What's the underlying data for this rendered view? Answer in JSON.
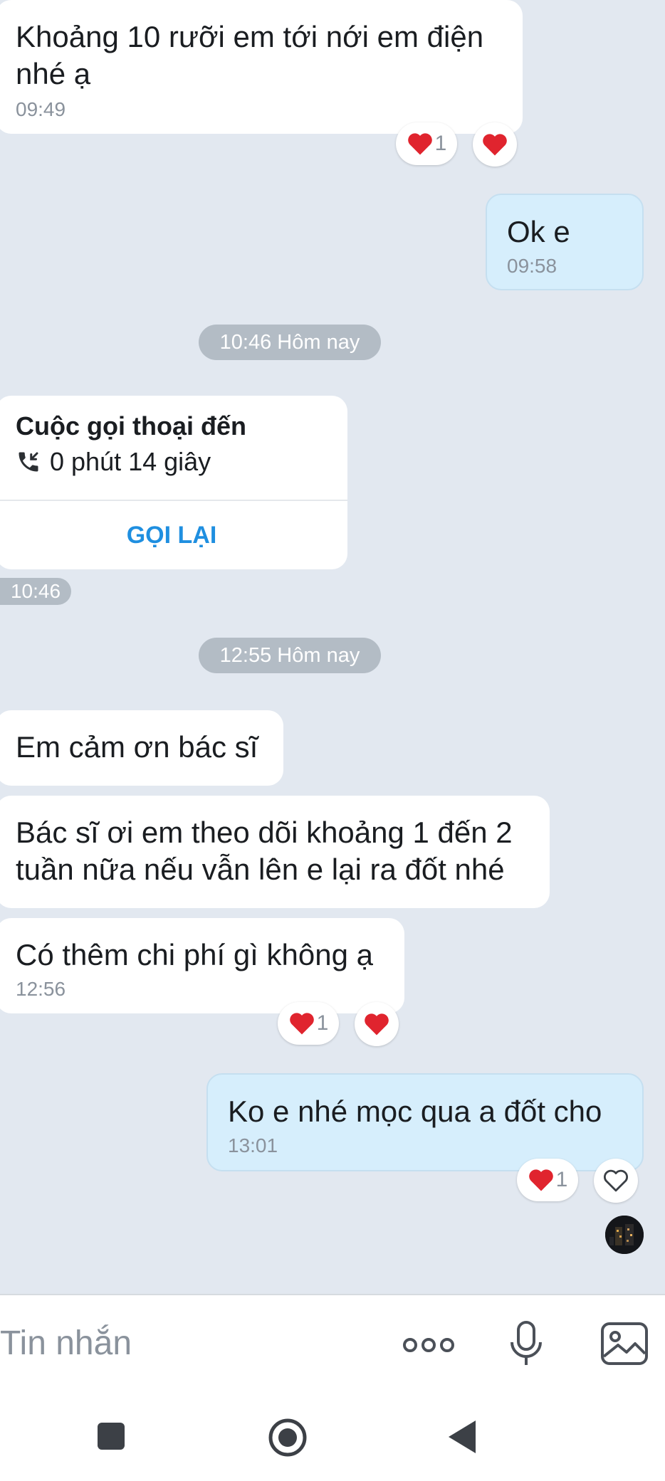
{
  "messages": {
    "m1": {
      "text": "Khoảng 10 rưỡi em tới nới em điện nhé ạ",
      "time": "09:49",
      "reaction_count": "1"
    },
    "m2": {
      "text": "Ok e",
      "time": "09:58"
    },
    "m3": {
      "text": "Em cảm ơn bác sĩ"
    },
    "m4": {
      "text": "Bác sĩ ơi em theo dõi khoảng 1 đến 2 tuần nữa nếu vẫn lên e lại ra đốt nhé"
    },
    "m5": {
      "text": "Có thêm chi phí gì không ạ",
      "time": "12:56",
      "reaction_count": "1"
    },
    "m6": {
      "text": "Ko e nhé mọc qua a đốt cho",
      "time": "13:01",
      "reaction_count": "1"
    }
  },
  "separators": {
    "s1": "10:46 Hôm nay",
    "s2": "12:55 Hôm nay"
  },
  "call_card": {
    "title": "Cuộc gọi thoại đến",
    "duration": "0 phút 14 giây",
    "action": "GỌI LẠI",
    "time": "10:46"
  },
  "composer": {
    "placeholder": "Tin nhắn"
  },
  "icons": {
    "heart": "heart-icon",
    "heart_outline": "heart-outline-icon",
    "phone_incoming": "phone-incoming-icon",
    "more": "more-icon",
    "mic": "microphone-icon",
    "image": "image-icon"
  },
  "colors": {
    "background": "#e2e8f0",
    "bubble_in": "#ffffff",
    "bubble_out": "#d6eefc",
    "accent": "#1f8fe0",
    "heart": "#e0242e"
  }
}
